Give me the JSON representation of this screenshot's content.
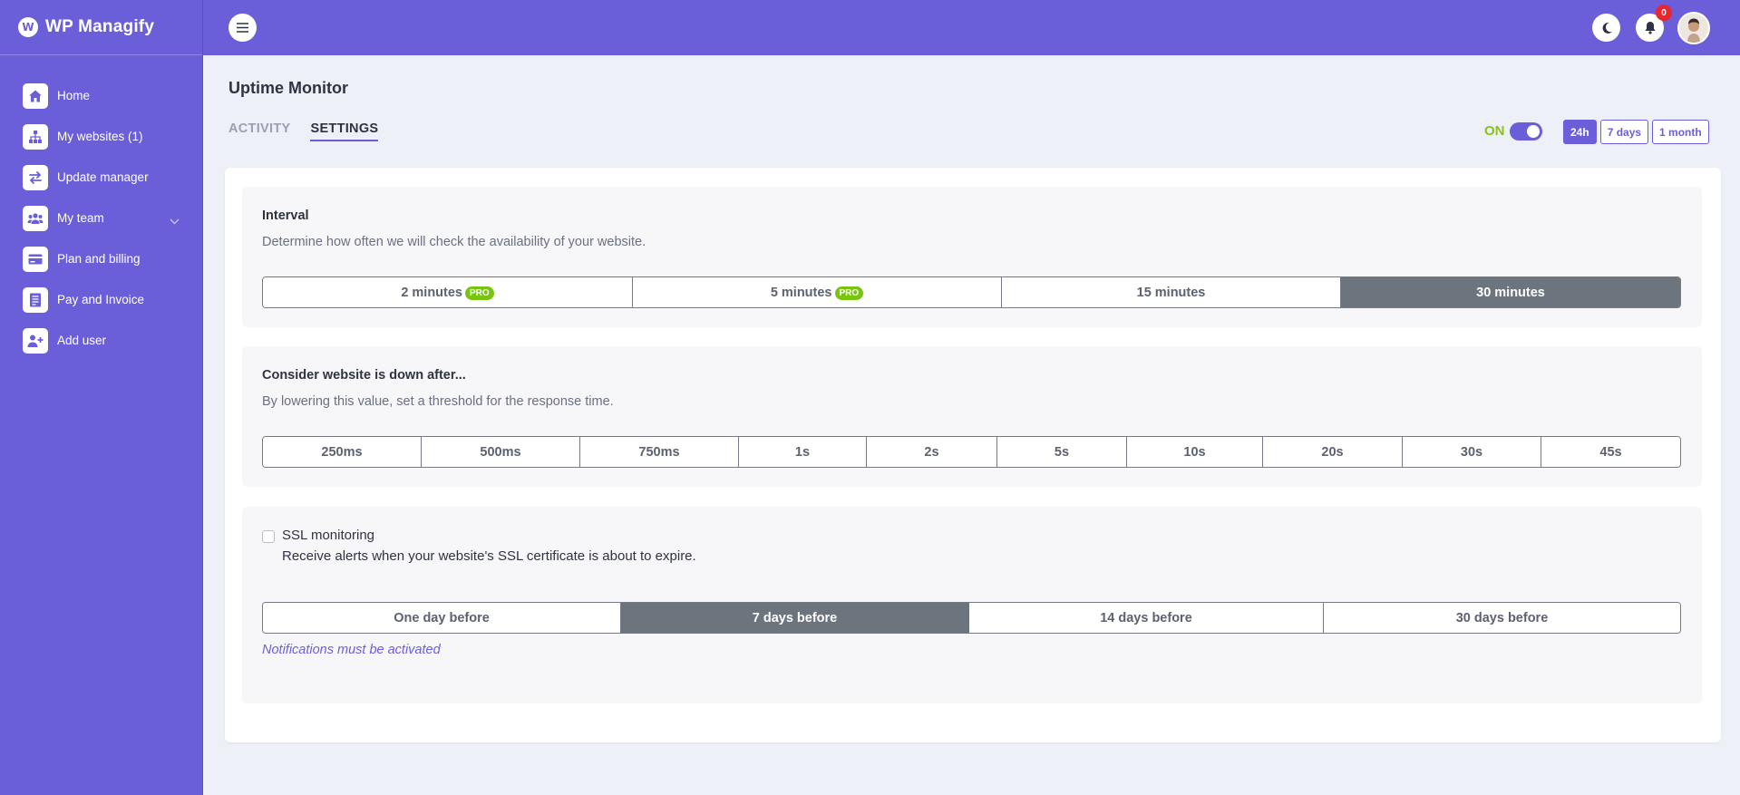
{
  "brand": {
    "name": "WP Managify",
    "logo_letter": "W"
  },
  "sidebar": {
    "items": [
      {
        "label": "Home",
        "icon": "home-icon"
      },
      {
        "label": "My websites (1)",
        "icon": "sitemap-icon"
      },
      {
        "label": "Update manager",
        "icon": "arrows-exchange-icon"
      },
      {
        "label": "My team",
        "icon": "users-icon",
        "has_chevron": true
      },
      {
        "label": "Plan and billing",
        "icon": "credit-card-icon"
      },
      {
        "label": "Pay and Invoice",
        "icon": "invoice-icon"
      },
      {
        "label": "Add user",
        "icon": "user-plus-icon"
      }
    ]
  },
  "topbar": {
    "notification_count": "0"
  },
  "page": {
    "title": "Uptime Monitor",
    "tabs": [
      {
        "label": "ACTIVITY",
        "active": false
      },
      {
        "label": "SETTINGS",
        "active": true
      }
    ],
    "status_label": "ON",
    "ranges": [
      {
        "label": "24h",
        "active": true
      },
      {
        "label": "7 days",
        "active": false
      },
      {
        "label": "1 month",
        "active": false
      }
    ]
  },
  "interval": {
    "title": "Interval",
    "description": "Determine how often we will check the availability of your website.",
    "options": [
      {
        "label": "2 minutes",
        "pro": "PRO"
      },
      {
        "label": "5 minutes",
        "pro": "PRO"
      },
      {
        "label": "15 minutes"
      },
      {
        "label": "30 minutes",
        "selected": true
      }
    ]
  },
  "threshold": {
    "title": "Consider website is down after...",
    "description": "By lowering this value, set a threshold for the response time.",
    "options": [
      "250ms",
      "500ms",
      "750ms",
      "1s",
      "2s",
      "5s",
      "10s",
      "20s",
      "30s",
      "45s"
    ]
  },
  "ssl": {
    "label": "SSL monitoring",
    "checked": false,
    "description": "Receive alerts when your website's SSL certificate is about to expire.",
    "options": [
      {
        "label": "One day before"
      },
      {
        "label": "7 days before",
        "selected": true
      },
      {
        "label": "14 days before"
      },
      {
        "label": "30 days before"
      }
    ],
    "note": "Notifications must be activated"
  },
  "colors": {
    "brand": "#6b5fd9",
    "pro_badge": "#78c510",
    "on_green": "#8bc21a",
    "selected_segment": "#6c757d",
    "notification_badge": "#e8262f"
  }
}
